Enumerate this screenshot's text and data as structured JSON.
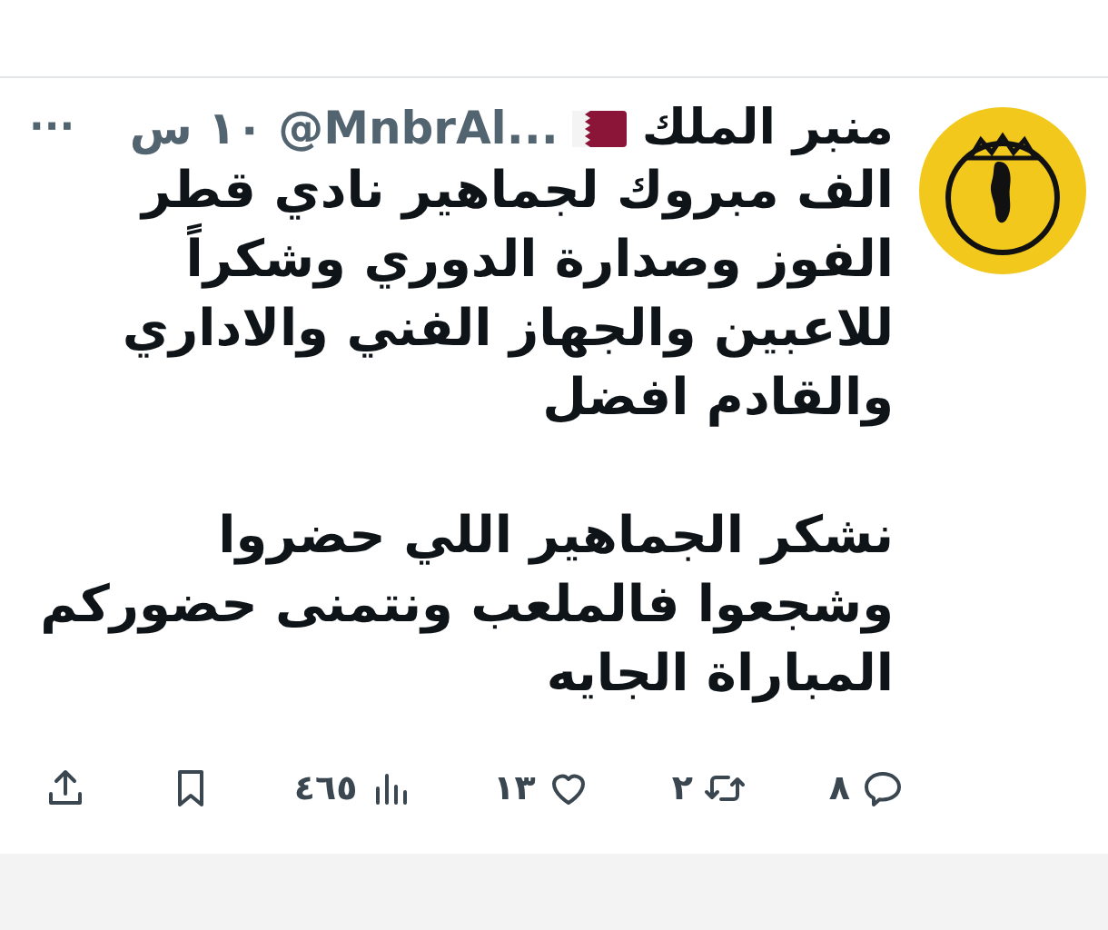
{
  "tweet": {
    "author_name": "منبر الملك",
    "handle": "@MnbrAl...",
    "time": "١٠ س",
    "more": "···",
    "text": "الف مبروك لجماهير نادي قطر\nالفوز وصدارة الدوري وشكراً\nللاعبين والجهاز الفني والاداري\nوالقادم افضل\n\nنشكر الجماهير اللي حضروا\nوشجعوا فالملعب ونتمنى حضوركم\nالمباراة الجايه"
  },
  "actions": [
    {
      "kind": "reply",
      "count": "٨"
    },
    {
      "kind": "retweet",
      "count": "٢"
    },
    {
      "kind": "like",
      "count": "١٣"
    },
    {
      "kind": "views",
      "count": "٤٦٥"
    },
    {
      "kind": "bookmark"
    },
    {
      "kind": "share"
    }
  ]
}
